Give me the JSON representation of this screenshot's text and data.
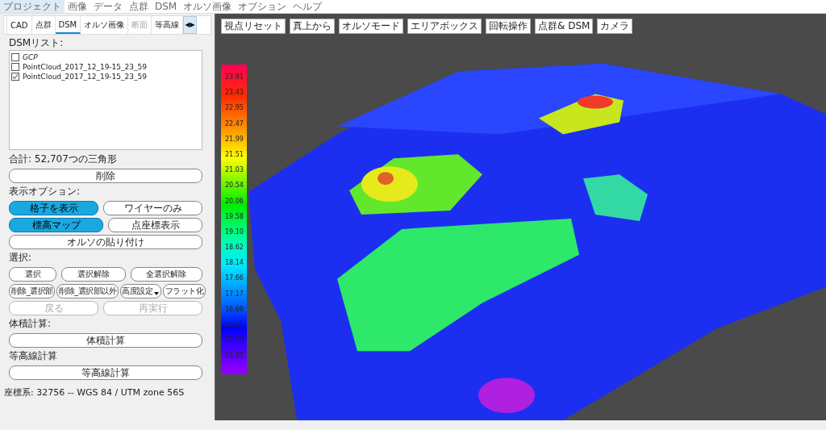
{
  "menu_bar": [
    {
      "label": "プロジェクト",
      "highlighted": true
    },
    {
      "label": "画像",
      "highlighted": false
    },
    {
      "label": "データ",
      "highlighted": false
    },
    {
      "label": "点群",
      "highlighted": false
    },
    {
      "label": "DSM",
      "highlighted": false
    },
    {
      "label": "オルソ画像",
      "highlighted": false
    },
    {
      "label": "オプション",
      "highlighted": false
    },
    {
      "label": "ヘルプ",
      "highlighted": false
    }
  ],
  "tabs": [
    {
      "label": "CAD",
      "selected": false,
      "disabled": false
    },
    {
      "label": "点群",
      "selected": false,
      "disabled": false
    },
    {
      "label": "DSM",
      "selected": true,
      "disabled": false
    },
    {
      "label": "オルソ画像",
      "selected": false,
      "disabled": false
    },
    {
      "label": "断面",
      "selected": false,
      "disabled": true
    },
    {
      "label": "等高線",
      "selected": false,
      "disabled": false
    }
  ],
  "tab_scroll": {
    "left": "◀",
    "right": "▶"
  },
  "panel": {
    "list_label": "DSMリスト:",
    "list_items": [
      {
        "label": "GCP",
        "checked": false,
        "italic": true
      },
      {
        "label": "PointCloud_2017_12_19-15_23_59",
        "checked": false,
        "italic": false
      },
      {
        "label": "PointCloud_2017_12_19-15_23_59",
        "checked": true,
        "italic": false
      }
    ],
    "total": "合計: 52,707つの三角形",
    "sections": [
      {
        "rows": [
          {
            "buttons": [
              {
                "label": "削除",
                "on": false,
                "disabled": false
              }
            ]
          }
        ]
      },
      {
        "title": "表示オプション:",
        "rows": [
          {
            "buttons": [
              {
                "label": "格子を表示",
                "on": true,
                "disabled": false
              },
              {
                "label": "ワイヤーのみ",
                "on": false,
                "disabled": false
              }
            ]
          },
          {
            "buttons": [
              {
                "label": "標高マップ",
                "on": true,
                "disabled": false
              },
              {
                "label": "点座標表示",
                "on": false,
                "disabled": false
              }
            ]
          },
          {
            "buttons": [
              {
                "label": "オルソの貼り付け",
                "on": false,
                "disabled": false
              }
            ]
          }
        ]
      },
      {
        "title": "選択:",
        "rows": [
          {
            "buttons": [
              {
                "label": "選択",
                "on": false,
                "disabled": false
              },
              {
                "label": "選択解除",
                "on": false,
                "disabled": false
              },
              {
                "label": "全選択解除",
                "on": false,
                "disabled": false
              }
            ]
          },
          {
            "buttons": [
              {
                "label": "削除_選択部",
                "on": false,
                "disabled": false
              },
              {
                "label": "削除_選択部以外",
                "on": false,
                "disabled": false
              },
              {
                "label": "高度設定",
                "on": false,
                "disabled": false,
                "kind": "dropdown"
              },
              {
                "label": "フラット化",
                "on": false,
                "disabled": false
              }
            ]
          },
          {
            "buttons": [
              {
                "label": "戻る",
                "on": false,
                "disabled": true
              },
              {
                "label": "再実行",
                "on": false,
                "disabled": true
              }
            ]
          }
        ]
      },
      {
        "title": "体積計算:",
        "rows": [
          {
            "buttons": [
              {
                "label": "体積計算",
                "on": false,
                "disabled": false
              }
            ]
          }
        ]
      },
      {
        "title": "等高線計算",
        "rows": [
          {
            "buttons": [
              {
                "label": "等高線計算",
                "on": false,
                "disabled": false
              }
            ]
          }
        ]
      }
    ],
    "status": "座標系: 32756 -- WGS 84 / UTM zone 56S"
  },
  "viewport": {
    "toolbar": [
      "視点リセット",
      "真上から",
      "オルソモード",
      "エリアボックス",
      "回転操作",
      "点群& DSM",
      "カメラ"
    ],
    "legend": {
      "labels": [
        "23.91",
        "23.43",
        "22.95",
        "22.47",
        "21.99",
        "21.51",
        "21.03",
        "20.54",
        "20.06",
        "19.58",
        "19.10",
        "18.62",
        "18.14",
        "17.66",
        "17.17",
        "16.69",
        "16.21",
        "15.73",
        "15.25"
      ]
    },
    "scene": {
      "kind": "picture"
    }
  }
}
